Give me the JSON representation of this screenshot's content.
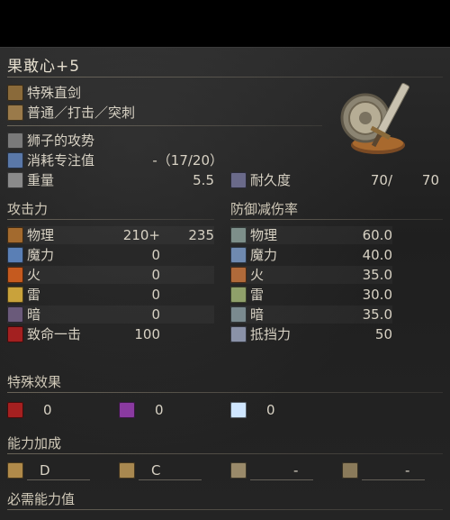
{
  "weapon": {
    "name": "果敢心+5",
    "type": "特殊直剑",
    "attack_type": "普通／打击／突刺",
    "skill": "狮子的攻势",
    "fp_cost_label": "消耗专注值",
    "fp_cost_value": "-（17/20）",
    "weight_label": "重量",
    "weight_value": "5.5",
    "durability_label": "耐久度",
    "durability_current": "70/",
    "durability_max": "70"
  },
  "attack": {
    "header": "攻击力",
    "rows": [
      {
        "label": "物理",
        "base": "210+",
        "bonus": "235",
        "icon": "physical-attack-icon",
        "color": "#a36a2e"
      },
      {
        "label": "魔力",
        "base": "0",
        "icon": "magic-attack-icon",
        "color": "#5a7fb5"
      },
      {
        "label": "火",
        "base": "0",
        "icon": "fire-attack-icon",
        "color": "#c55a1f"
      },
      {
        "label": "雷",
        "base": "0",
        "icon": "lightning-attack-icon",
        "color": "#c9a23b"
      },
      {
        "label": "暗",
        "base": "0",
        "icon": "dark-attack-icon",
        "color": "#6a5a7a"
      },
      {
        "label": "致命一击",
        "base": "100",
        "icon": "critical-icon",
        "color": "#a32020"
      }
    ]
  },
  "defense": {
    "header": "防御减伤率",
    "rows": [
      {
        "label": "物理",
        "value": "60.0",
        "icon": "physical-defense-icon",
        "color": "#7d8f8a"
      },
      {
        "label": "魔力",
        "value": "40.0",
        "icon": "magic-defense-icon",
        "color": "#6f8ab0"
      },
      {
        "label": "火",
        "value": "35.0",
        "icon": "fire-defense-icon",
        "color": "#b06a3a"
      },
      {
        "label": "雷",
        "value": "30.0",
        "icon": "lightning-defense-icon",
        "color": "#8fa06a"
      },
      {
        "label": "暗",
        "value": "35.0",
        "icon": "dark-defense-icon",
        "color": "#7a8a8f"
      },
      {
        "label": "抵挡力",
        "value": "50",
        "icon": "stability-icon",
        "color": "#8a92a8"
      }
    ]
  },
  "effects": {
    "header": "特殊效果",
    "items": [
      {
        "value": "0",
        "icon": "bleed-icon",
        "color": "#a52020"
      },
      {
        "value": "0",
        "icon": "poison-icon",
        "color": "#8a3aa0"
      },
      {
        "value": "0",
        "icon": "frost-icon",
        "color": "#cfe6ff"
      }
    ]
  },
  "scaling": {
    "header": "能力加成",
    "items": [
      {
        "value": "D",
        "icon": "strength-scaling-icon",
        "color": "#b08a4a"
      },
      {
        "value": "C",
        "icon": "dexterity-scaling-icon",
        "color": "#a88850"
      },
      {
        "value": "-",
        "icon": "intelligence-scaling-icon",
        "color": "#9a8a6a"
      },
      {
        "value": "-",
        "icon": "faith-scaling-icon",
        "color": "#8a7a5a"
      }
    ]
  },
  "requirements": {
    "header": "必需能力值"
  }
}
